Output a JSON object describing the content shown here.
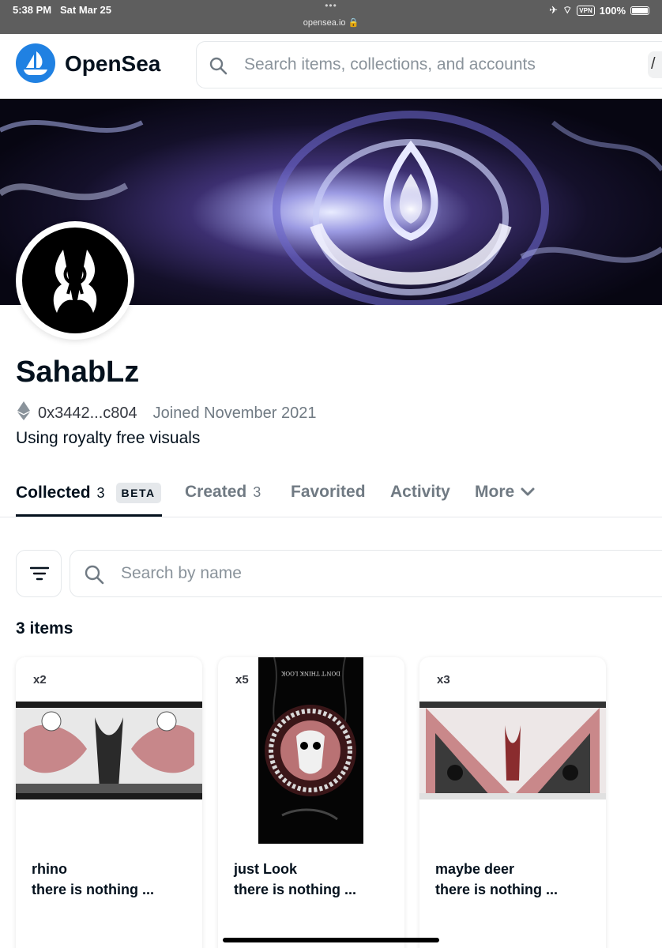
{
  "status_bar": {
    "time": "5:38 PM",
    "date": "Sat Mar 25",
    "dots": "•••",
    "url": "opensea.io",
    "vpn": "VPN",
    "battery": "100%"
  },
  "header": {
    "brand": "OpenSea",
    "search_placeholder": "Search items, collections, and accounts",
    "search_shortcut": "/"
  },
  "profile": {
    "name": "SahabLz",
    "address": "0x3442...c804",
    "joined": "Joined November 2021",
    "bio": "Using royalty free visuals"
  },
  "tabs": [
    {
      "label": "Collected",
      "count": "3",
      "badge": "BETA",
      "active": true
    },
    {
      "label": "Created",
      "count": "3"
    },
    {
      "label": "Favorited"
    },
    {
      "label": "Activity"
    },
    {
      "label": "More"
    }
  ],
  "filter": {
    "search_placeholder": "Search by name"
  },
  "items_count": "3 items",
  "items": [
    {
      "qty": "x2",
      "title": "rhino",
      "collection": "there is nothing ..."
    },
    {
      "qty": "x5",
      "title": "just Look",
      "collection": "there is nothing ...",
      "art_text": "DON'T THINK  LOOK"
    },
    {
      "qty": "x3",
      "title": "maybe deer",
      "collection": "there is nothing ..."
    }
  ],
  "colors": {
    "brand_blue": "#2081e2",
    "text_primary": "#04111d",
    "text_secondary": "#707a83",
    "border": "#e5e8eb"
  }
}
